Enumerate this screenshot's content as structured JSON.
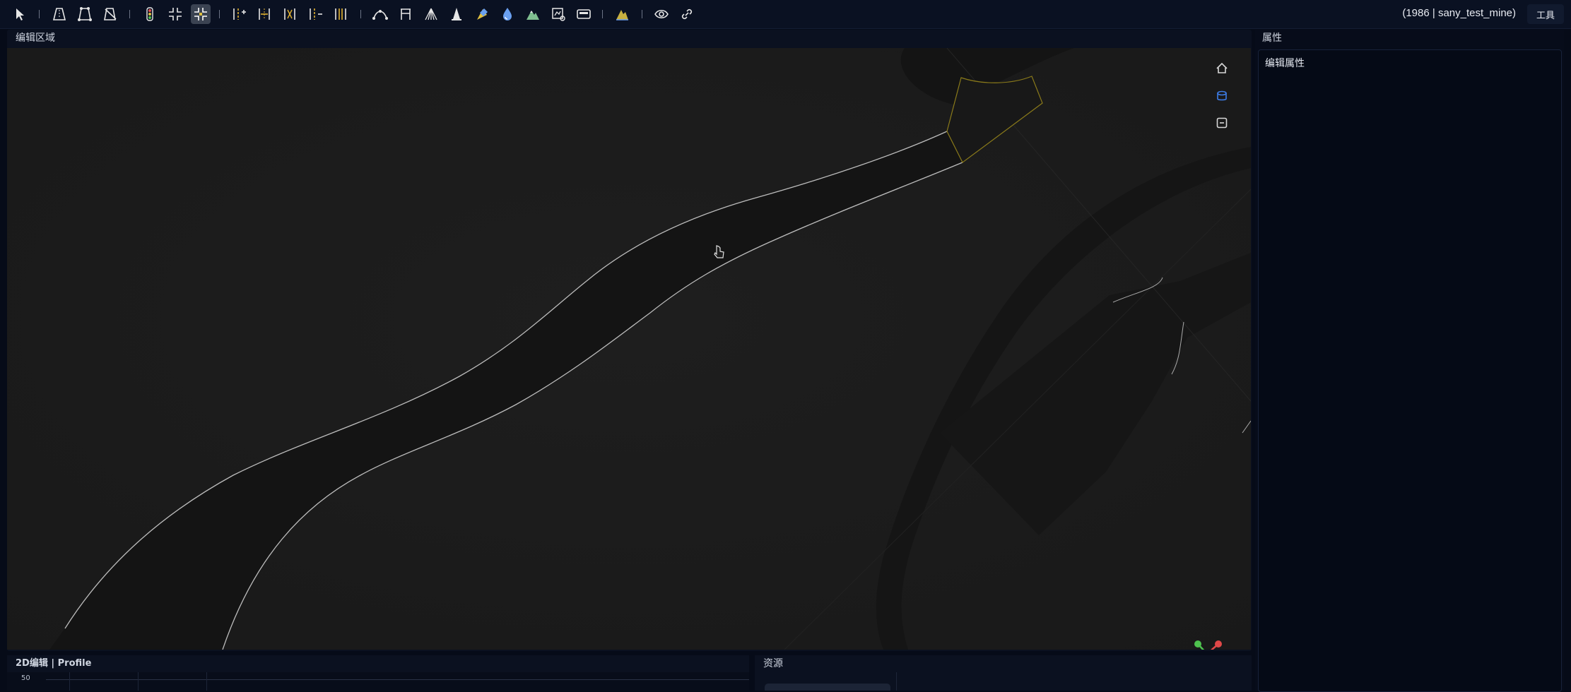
{
  "toolbar": {
    "tools": [
      {
        "name": "select-pointer-icon",
        "active": false
      },
      {
        "name": "road-icon",
        "active": false
      },
      {
        "name": "road-edit-icon",
        "active": false
      },
      {
        "name": "road-delete-icon",
        "active": false
      },
      {
        "name": "traffic-light-icon",
        "active": false
      },
      {
        "name": "junction-icon",
        "active": false
      },
      {
        "name": "junction-edit-icon",
        "active": true
      },
      {
        "name": "lane-add-icon",
        "active": false
      },
      {
        "name": "lane-width-icon",
        "active": false
      },
      {
        "name": "lane-link-icon",
        "active": false
      },
      {
        "name": "lane-split-icon",
        "active": false
      },
      {
        "name": "lane-marking-icon",
        "active": false
      },
      {
        "name": "curve-icon",
        "active": false
      },
      {
        "name": "bridge-icon",
        "active": false
      },
      {
        "name": "pedestrian-crossing-icon",
        "active": false
      },
      {
        "name": "cone-icon",
        "active": false
      },
      {
        "name": "terrain-paint-icon",
        "active": false
      },
      {
        "name": "water-icon",
        "active": false
      },
      {
        "name": "mountain-icon",
        "active": false
      },
      {
        "name": "map-edit-icon",
        "active": false
      },
      {
        "name": "bus-stop-icon",
        "active": false
      },
      {
        "name": "elevation-icon",
        "active": false
      },
      {
        "name": "eye-icon",
        "active": false
      },
      {
        "name": "link-icon",
        "active": false
      }
    ],
    "project_label": "(1986 | sany_test_mine)",
    "tools_menu_label": "工具"
  },
  "edit_area": {
    "title": "编辑区域",
    "side_icons": [
      "home-icon",
      "layer-icon",
      "collapse-icon"
    ],
    "view_cubes": [
      "view-cube-top-icon",
      "view-cube-front-icon",
      "view-cube-right-icon",
      "view-cube-left-icon",
      "view-cube-perspective-icon"
    ],
    "axis_gizmo": {
      "x_color": "#e04848",
      "y_color": "#4ec24e",
      "z_color": "#3d7de8"
    }
  },
  "properties": {
    "title": "属性",
    "section_label": "编辑属性"
  },
  "profile": {
    "title": "2D编辑 | Profile",
    "axis_tick": "50"
  },
  "resources": {
    "title": "资源"
  },
  "colors": {
    "toolbar_bg": "#0a1122",
    "viewport_bg": "#1b1b1b",
    "road_surface": "#131313",
    "road_edge": "#bcbcbc",
    "junction_outline": "#8a7a1a",
    "accent": "#3d7de8"
  }
}
